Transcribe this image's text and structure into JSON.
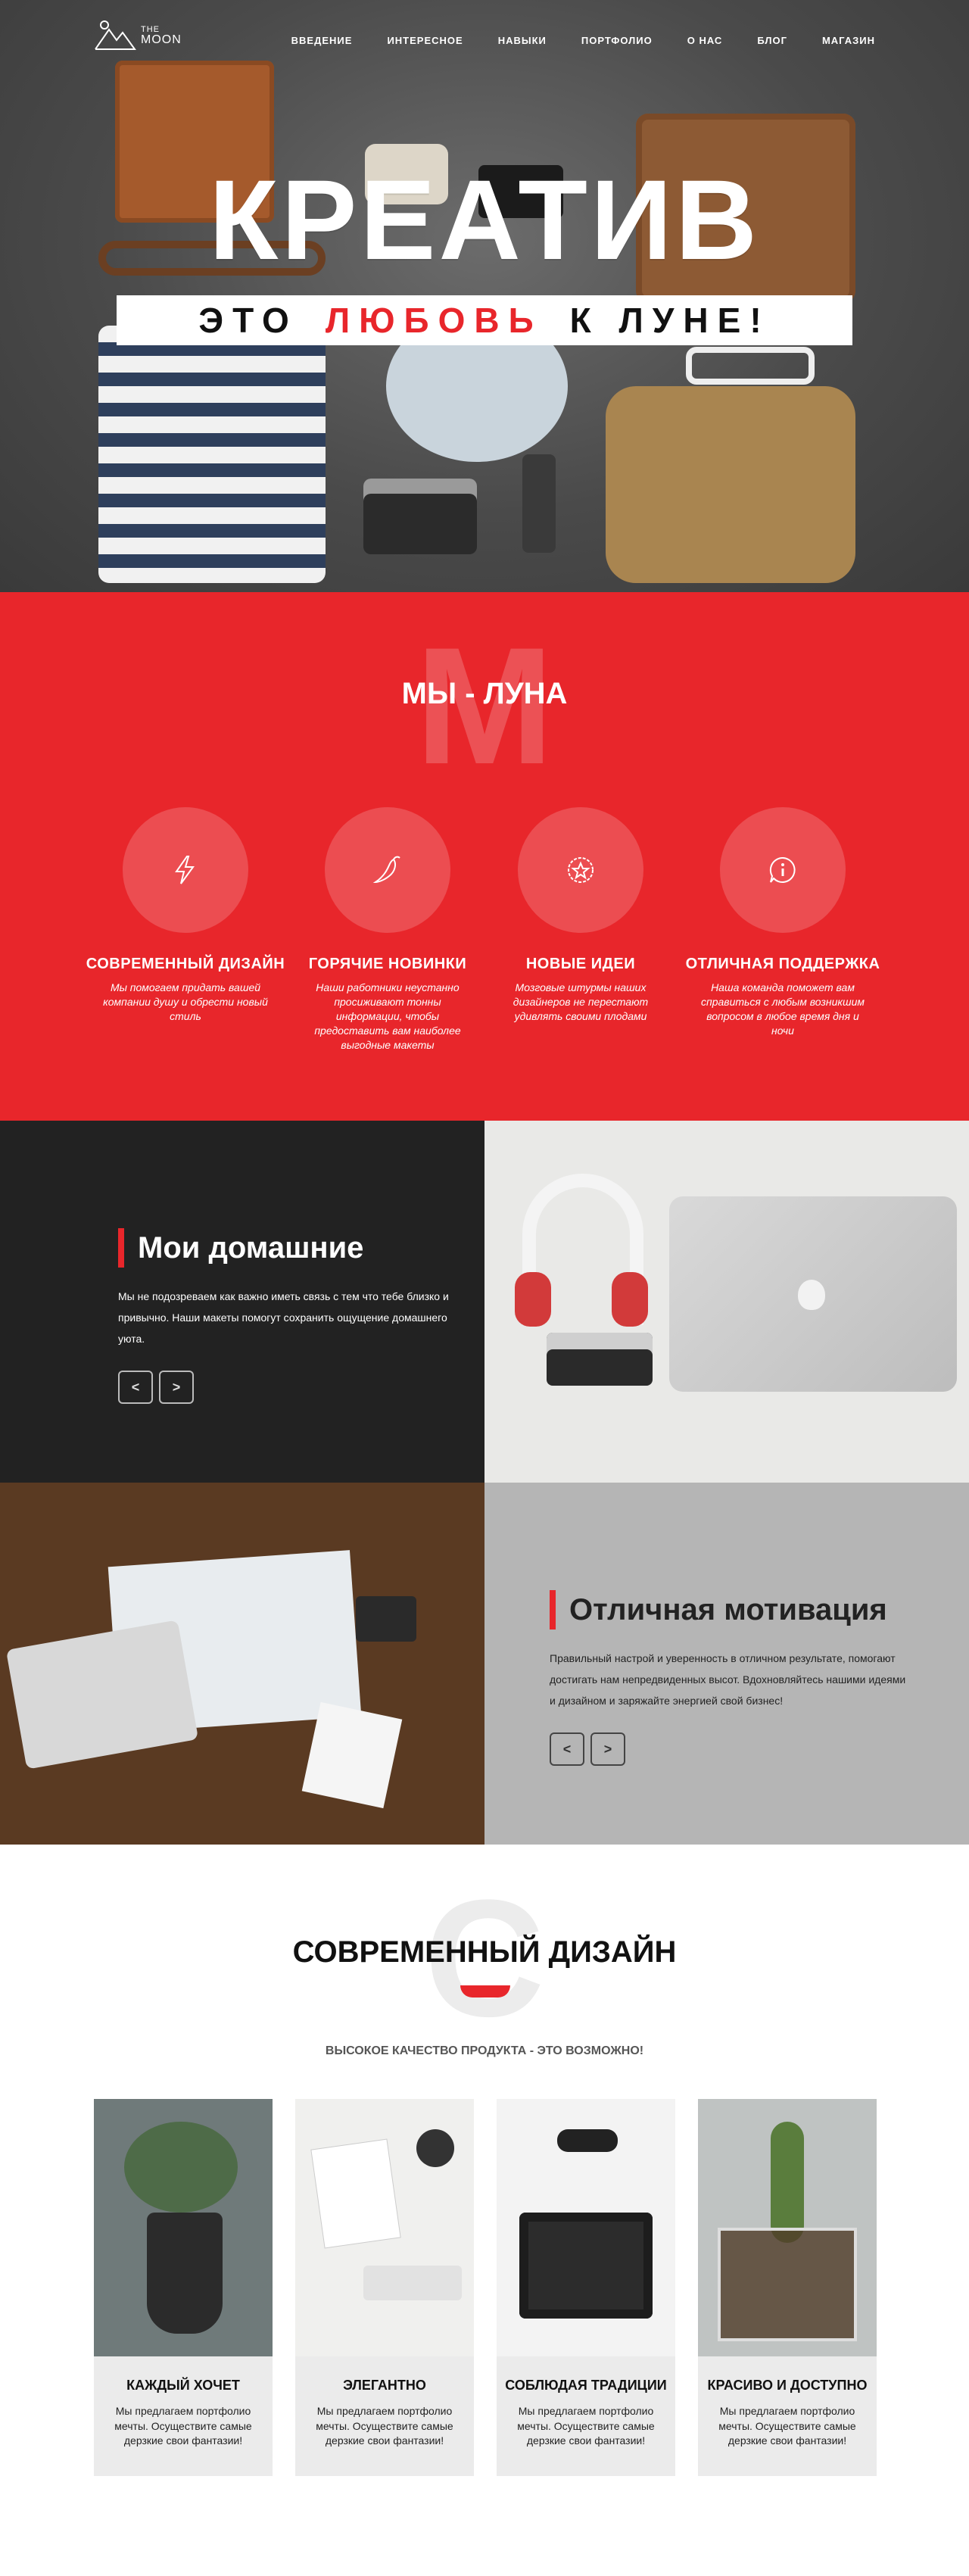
{
  "nav": {
    "logo_the": "THE",
    "logo_moon": "MOON",
    "items": [
      "ВВЕДЕНИЕ",
      "ИНТЕРЕСНОЕ",
      "НАВЫКИ",
      "ПОРТФОЛИО",
      "О НАС",
      "БЛОГ",
      "МАГАЗИН"
    ]
  },
  "hero": {
    "title": "КРЕАТИВ",
    "ribbon_part1": "ЭТО",
    "ribbon_red": "ЛЮБОВЬ",
    "ribbon_part2": "К ЛУНЕ!"
  },
  "about": {
    "big_letter": "М",
    "title": "МЫ - ЛУНА",
    "features": [
      {
        "icon": "lightning-icon",
        "title": "СОВРЕМЕННЫЙ ДИЗАЙН",
        "text": "Мы помогаем придать вашей компании душу и обрести новый стиль"
      },
      {
        "icon": "chili-pepper-icon",
        "title": "ГОРЯЧИЕ НОВИНКИ",
        "text": "Наши работники неустанно просиживают тонны информации, чтобы предоставить вам наиболее выгодные макеты"
      },
      {
        "icon": "badge-star-icon",
        "title": "НОВЫЕ ИДЕИ",
        "text": "Мозговые штурмы наших дизайнеров не перестают удивлять своими плодами"
      },
      {
        "icon": "info-chat-icon",
        "title": "ОТЛИЧНАЯ ПОДДЕРЖКА",
        "text": "Наша команда поможет вам справиться с любым возникшим вопросом в любое время дня и ночи"
      }
    ]
  },
  "home_block": {
    "title": "Мои домашние",
    "text": "Мы не подозреваем как важно иметь связь с тем что тебе близко и привычно. Наши макеты помогут сохранить ощущение домашнего уюта.",
    "prev": "<",
    "next": ">"
  },
  "motivation_block": {
    "title": "Отличная мотивация",
    "text": "Правильный настрой и уверенность в отличном результате, помогают достигать нам непредвиденных высот. Вдохновляйтесь нашими идеями и дизайном и заряжайте энергией свой бизнес!",
    "prev": "<",
    "next": ">"
  },
  "modern": {
    "big_letter": "С",
    "title": "СОВРЕМЕННЫЙ ДИЗАЙН",
    "subtitle": "ВЫСОКОЕ КАЧЕСТВО ПРОДУКТА - ЭТО ВОЗМОЖНО!",
    "cards": [
      {
        "title": "КАЖДЫЙ ХОЧЕТ",
        "text": "Мы предлагаем портфолио мечты. Осуществите самые дерзкие свои фантазии!"
      },
      {
        "title": "ЭЛЕГАНТНО",
        "text": "Мы предлагаем портфолио мечты. Осуществите самые дерзкие свои фантазии!"
      },
      {
        "title": "СОБЛЮДАЯ ТРАДИЦИИ",
        "text": "Мы предлагаем портфолио мечты. Осуществите самые дерзкие свои фантазии!"
      },
      {
        "title": "КРАСИВО И ДОСТУПНО",
        "text": "Мы предлагаем портфолио мечты. Осуществите самые дерзкие свои фантазии!"
      }
    ]
  },
  "colors": {
    "accent": "#e8262b",
    "dark": "#222222",
    "grey": "#b5b5b5"
  }
}
